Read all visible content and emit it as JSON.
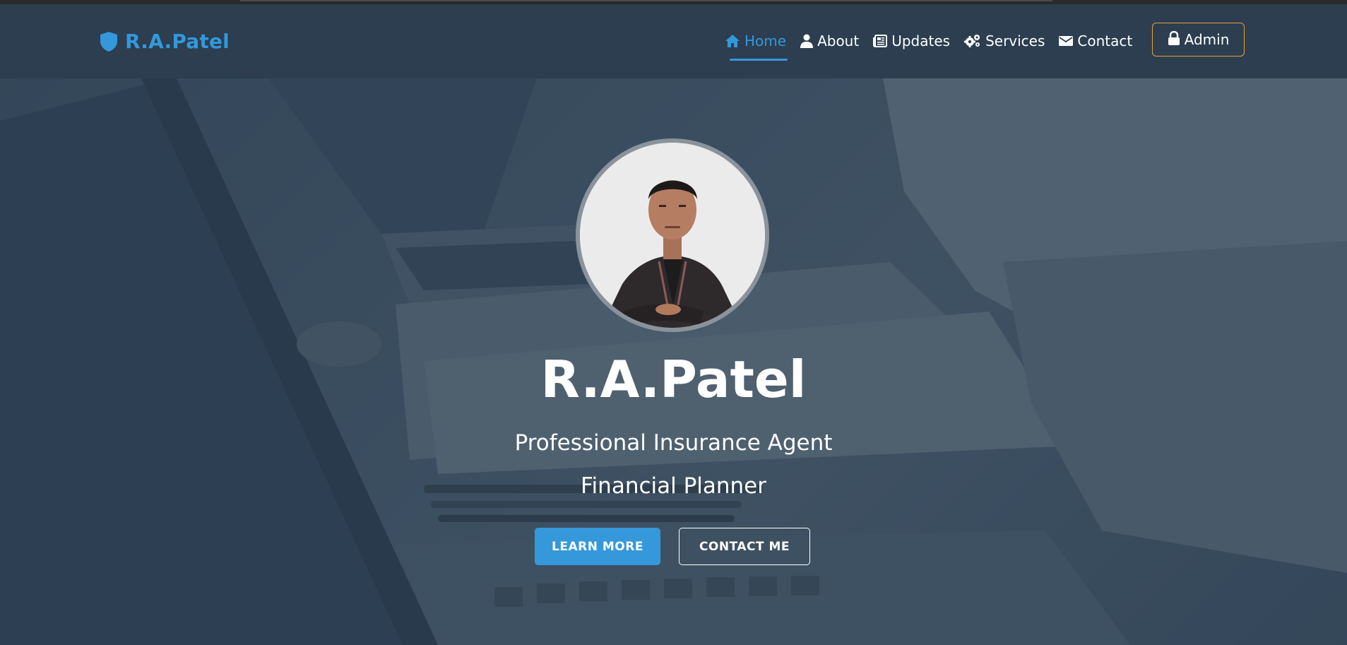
{
  "brand": {
    "name": "R.A.Patel",
    "icon": "shield-icon"
  },
  "nav": {
    "items": [
      {
        "label": "Home",
        "icon": "home-icon",
        "active": true
      },
      {
        "label": "About",
        "icon": "user-icon",
        "active": false
      },
      {
        "label": "Updates",
        "icon": "newspaper-icon",
        "active": false
      },
      {
        "label": "Services",
        "icon": "gears-icon",
        "active": false
      },
      {
        "label": "Contact",
        "icon": "envelope-icon",
        "active": false
      }
    ],
    "admin_label": "Admin",
    "admin_icon": "lock-icon"
  },
  "hero": {
    "name": "R.A.Patel",
    "subtitle_1": "Professional Insurance Agent",
    "subtitle_2": "Financial Planner",
    "learn_more_label": "LEARN MORE",
    "contact_label": "CONTACT ME"
  },
  "colors": {
    "accent": "#3498db",
    "navbar_bg": "#2c3e50",
    "admin_border": "#e6a23c"
  }
}
